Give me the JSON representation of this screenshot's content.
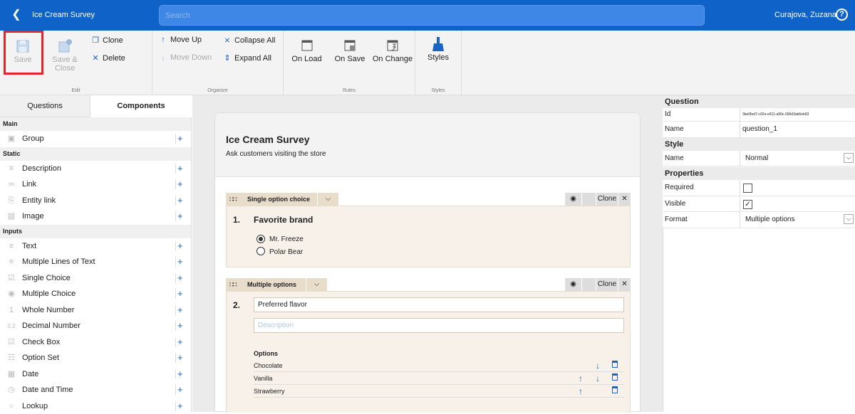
{
  "app": {
    "title": "Ice Cream Survey",
    "search_placeholder": "Search",
    "user": "Curajova, Zuzana",
    "help": "?"
  },
  "ribbon": {
    "save": "Save",
    "save_close": "Save & Close",
    "clone": "Clone",
    "delete": "Delete",
    "edit_label": "Edit",
    "move_up": "Move Up",
    "move_down": "Move Down",
    "collapse_all": "Collapse All",
    "expand_all": "Expand All",
    "organize_label": "Organize",
    "on_load": "On Load",
    "on_save": "On Save",
    "on_change": "On Change",
    "rules_label": "Rules",
    "styles": "Styles",
    "styles_label": "Styles"
  },
  "left": {
    "tab_questions": "Questions",
    "tab_components": "Components",
    "sections": [
      {
        "name": "Main",
        "items": [
          {
            "label": "Group",
            "icon": "group-icon"
          }
        ]
      },
      {
        "name": "Static",
        "items": [
          {
            "label": "Description",
            "icon": "lines-icon"
          },
          {
            "label": "Link",
            "icon": "link-icon"
          },
          {
            "label": "Entity link",
            "icon": "entity-link-icon"
          },
          {
            "label": "Image",
            "icon": "image-icon"
          }
        ]
      },
      {
        "name": "Inputs",
        "items": [
          {
            "label": "Text",
            "icon": "text-icon"
          },
          {
            "label": "Multiple Lines of Text",
            "icon": "lines-icon"
          },
          {
            "label": "Single Choice",
            "icon": "check-icon"
          },
          {
            "label": "Multiple Choice",
            "icon": "radio-icon"
          },
          {
            "label": "Whole Number",
            "icon": "number-icon"
          },
          {
            "label": "Decimal Number",
            "icon": "decimal-icon"
          },
          {
            "label": "Check Box",
            "icon": "checkbox-icon"
          },
          {
            "label": "Option Set",
            "icon": "list-icon"
          },
          {
            "label": "Date",
            "icon": "calendar-icon"
          },
          {
            "label": "Date and Time",
            "icon": "clock-icon"
          },
          {
            "label": "Lookup",
            "icon": "lookup-icon"
          }
        ]
      }
    ]
  },
  "form": {
    "title": "Ice Cream Survey",
    "subtitle": "Ask customers visiting the store",
    "q1": {
      "type": "Single option choice",
      "clone": "Clone",
      "num": "1.",
      "title": "Favorite brand",
      "options": [
        "Mr. Freeze",
        "Polar Bear"
      ]
    },
    "q2": {
      "type": "Multiple options",
      "clone": "Clone",
      "num": "2.",
      "title": "Preferred flavor",
      "desc_placeholder": "Description",
      "options_label": "Options",
      "options": [
        "Chocolate",
        "Vanilla",
        "Strawberry"
      ]
    }
  },
  "props": {
    "question_head": "Question",
    "id_label": "Id",
    "id_value": "3be0fed7-c92e-e911-a99c-000d3ab6eb93",
    "name_label": "Name",
    "name_value": "question_1",
    "style_head": "Style",
    "style_name_label": "Name",
    "style_name_value": "Normal",
    "properties_head": "Properties",
    "required_label": "Required",
    "visible_label": "Visible",
    "format_label": "Format",
    "format_value": "Multiple options"
  }
}
